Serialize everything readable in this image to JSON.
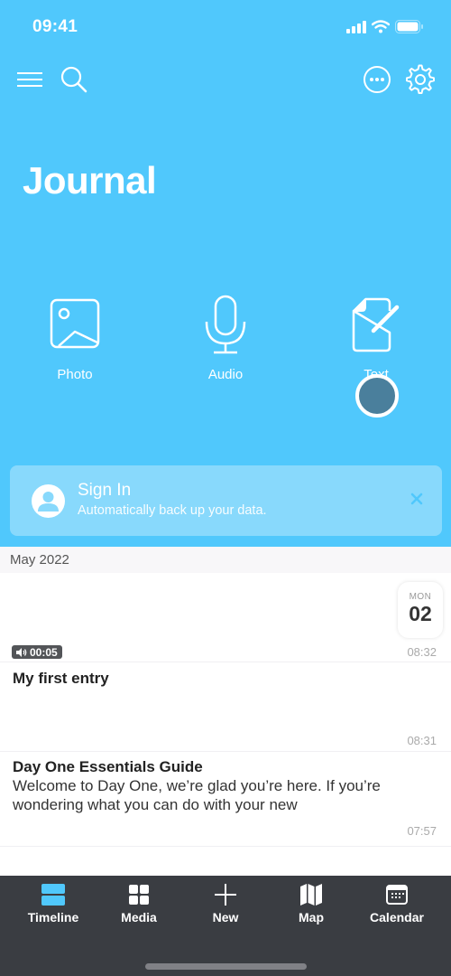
{
  "status_bar": {
    "time": "09:41"
  },
  "toolbar": {
    "menu_icon": "hamburger-menu-icon",
    "search_icon": "search-icon",
    "more_icon": "ellipsis-circle-icon",
    "settings_icon": "gear-icon"
  },
  "journal": {
    "title": "Journal"
  },
  "quick_actions": [
    {
      "label": "Photo",
      "icon": "photo-icon"
    },
    {
      "label": "Audio",
      "icon": "microphone-icon"
    },
    {
      "label": "Text",
      "icon": "document-pencil-icon"
    }
  ],
  "signin_banner": {
    "title": "Sign In",
    "subtitle": "Automatically back up your data."
  },
  "section": {
    "label": "May 2022"
  },
  "entries": [
    {
      "day_of_week": "MON",
      "day": "02",
      "audio_duration": "00:05",
      "time": "08:32"
    },
    {
      "title": "My first entry",
      "time": "08:31"
    },
    {
      "title": "Day One Essentials Guide",
      "body": "Welcome to Day One, we’re glad you’re here. If you’re wondering what you can do with your new",
      "time": "07:57"
    }
  ],
  "tabs": [
    {
      "label": "Timeline",
      "icon": "timeline-icon",
      "active": true
    },
    {
      "label": "Media",
      "icon": "grid-icon",
      "active": false
    },
    {
      "label": "New",
      "icon": "plus-icon",
      "active": false
    },
    {
      "label": "Map",
      "icon": "map-icon",
      "active": false
    },
    {
      "label": "Calendar",
      "icon": "calendar-icon",
      "active": false
    }
  ],
  "colors": {
    "brand": "#50c8fc",
    "tabbar": "#3a3d42",
    "active_tab": "#50c8fc"
  }
}
